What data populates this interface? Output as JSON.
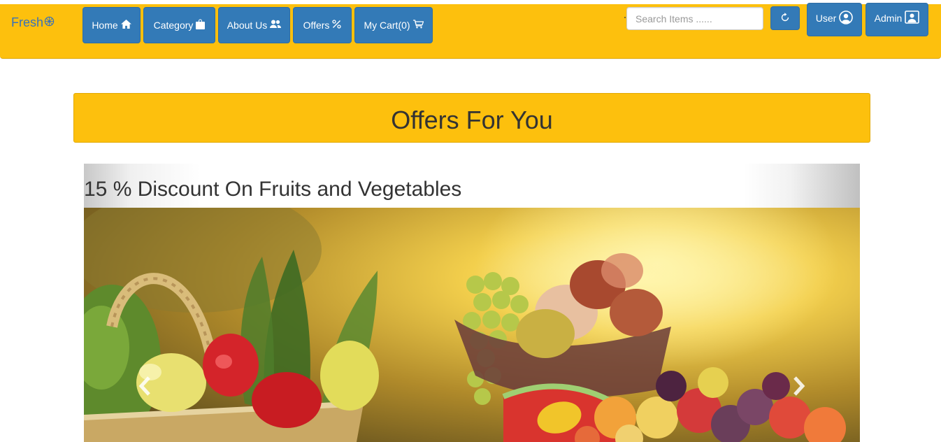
{
  "brand": {
    "name": "Fresh",
    "icon": "wheel-icon"
  },
  "nav": {
    "home": "Home",
    "category": "Category",
    "about": "About Us",
    "offers": "Offers",
    "cart": "My Cart(0)"
  },
  "search": {
    "placeholder": "Search Items ......"
  },
  "account": {
    "user": "User",
    "admin": "Admin"
  },
  "page": {
    "heading": "Offers For You"
  },
  "carousel": {
    "caption": "15 % Discount On Fruits and Vegetables",
    "image": "fruits-and-vegetables-basket-photo",
    "prev_icon": "chevron-left-icon",
    "next_icon": "chevron-right-icon"
  },
  "colors": {
    "navbar": "#fdc00d",
    "button": "#337ab7",
    "brand_text": "#3a72b8"
  }
}
